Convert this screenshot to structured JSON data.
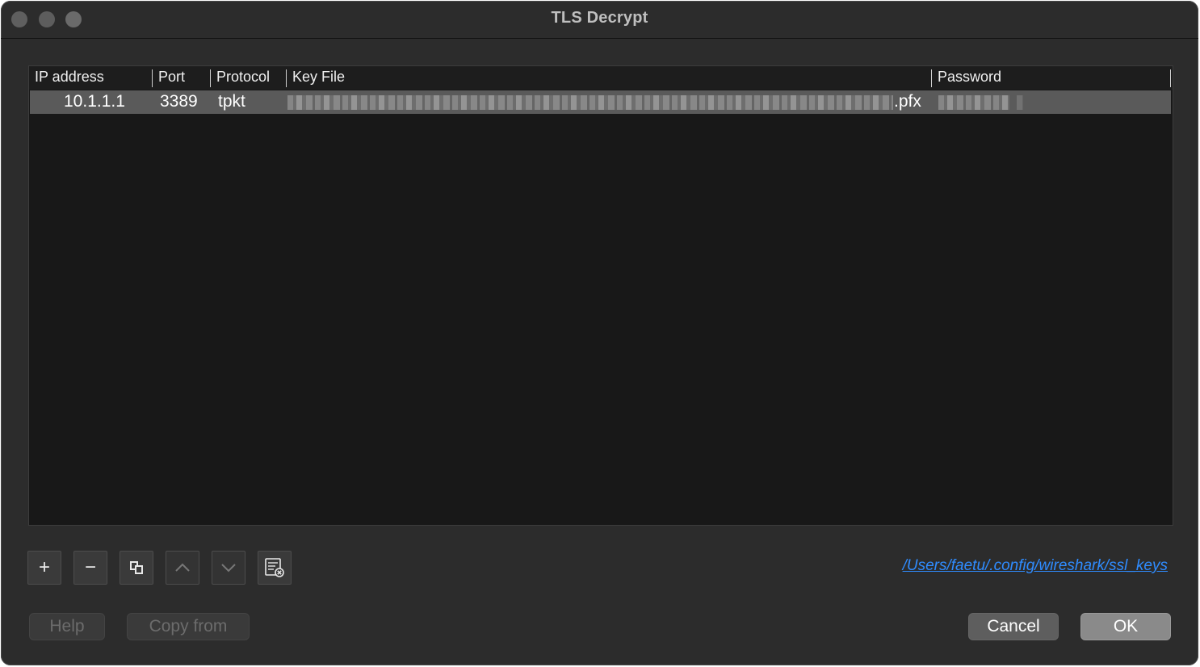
{
  "window": {
    "title": "TLS Decrypt"
  },
  "table": {
    "columns": [
      "IP address",
      "Port",
      "Protocol",
      "Key File",
      "Password"
    ],
    "rows": [
      {
        "ip": "10.1.1.1",
        "port": "3389",
        "protocol": "tpkt",
        "key_file_suffix": ".pfx"
      }
    ]
  },
  "toolbar": {
    "icons": [
      "plus-icon",
      "minus-icon",
      "copy-icon",
      "chevron-up-icon",
      "chevron-down-icon",
      "clear-list-icon"
    ],
    "plus_label": "+",
    "minus_label": "−"
  },
  "config_path": "/Users/faetu/.config/wireshark/ssl_keys",
  "buttons": {
    "help": "Help",
    "copy_from": "Copy from",
    "cancel": "Cancel",
    "ok": "OK"
  }
}
